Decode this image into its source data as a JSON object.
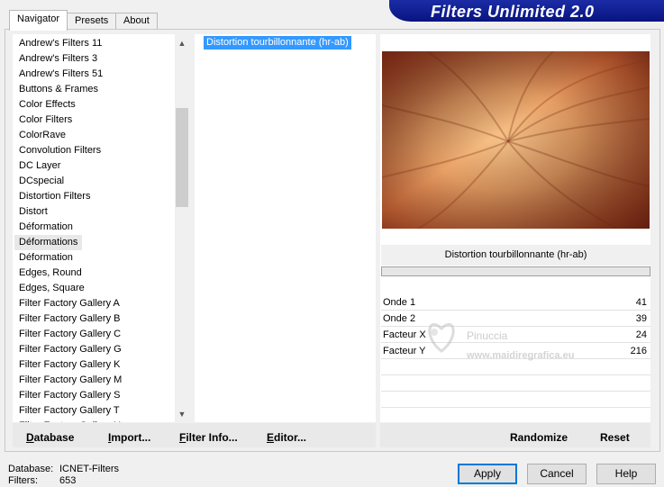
{
  "header": {
    "banner": "Filters Unlimited 2.0"
  },
  "tabs": [
    {
      "label": "Navigator",
      "active": true
    },
    {
      "label": "Presets",
      "active": false
    },
    {
      "label": "About",
      "active": false
    }
  ],
  "categories": [
    "Andrew's Filters 11",
    "Andrew's Filters 3",
    "Andrew's Filters 51",
    "Buttons & Frames",
    "Color Effects",
    "Color Filters",
    "ColorRave",
    "Convolution Filters",
    "DC Layer",
    "DCspecial",
    "Distortion Filters",
    "Distort",
    "Déformation",
    "Déformations",
    "Déformation",
    "Edges, Round",
    "Edges, Square",
    "Filter Factory Gallery A",
    "Filter Factory Gallery B",
    "Filter Factory Gallery C",
    "Filter Factory Gallery G",
    "Filter Factory Gallery K",
    "Filter Factory Gallery M",
    "Filter Factory Gallery S",
    "Filter Factory Gallery T",
    "Filter Factory Gallery U"
  ],
  "selected_category_index": 13,
  "filters": [
    "Distortion tourbillonnante (hr-ab)"
  ],
  "preview": {
    "filter_name": "Distortion tourbillonnante (hr-ab)"
  },
  "params": [
    {
      "name": "Onde 1",
      "value": "41"
    },
    {
      "name": "Onde 2",
      "value": "39"
    },
    {
      "name": "Facteur X",
      "value": "24"
    },
    {
      "name": "Facteur Y",
      "value": "216"
    }
  ],
  "watermark": {
    "line1": "Pinuccia",
    "line2": "www.maidiregrafica.eu"
  },
  "left_buttons": [
    {
      "label": "Database",
      "ul": "D"
    },
    {
      "label": "Import...",
      "ul": "I"
    },
    {
      "label": "Filter Info...",
      "ul": "F"
    },
    {
      "label": "Editor...",
      "ul": "E"
    }
  ],
  "right_buttons": {
    "randomize": "Randomize",
    "reset": "Reset"
  },
  "status": {
    "database_label": "Database:",
    "database_value": "ICNET-Filters",
    "filters_label": "Filters:",
    "filters_value": "653"
  },
  "dialog_buttons": {
    "apply": "Apply",
    "cancel": "Cancel",
    "help": "Help"
  },
  "colors": {
    "selection": "#3399ff",
    "banner": "#0d1c95",
    "default_button_border": "#0078d7"
  }
}
